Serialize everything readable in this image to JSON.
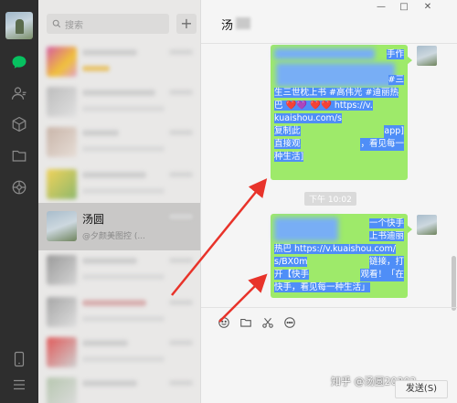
{
  "sidebar": {
    "icons": [
      "chat-icon",
      "contacts-icon",
      "favorites-icon",
      "files-icon",
      "moments-icon",
      "phone-icon",
      "menu-icon"
    ]
  },
  "list": {
    "search_placeholder": "搜索",
    "add_label": "+",
    "selected_chat": {
      "name": "汤圆",
      "preview": "@夕颜美图控 (..."
    }
  },
  "chat": {
    "title": "汤",
    "window_controls": [
      "—",
      "□",
      "✕"
    ],
    "message1": {
      "lines": [
        "手作",
        "",
        "#三",
        "生三世枕上书 #高伟光 #迪丽热",
        "巴 ❤️💜 ❤️❤️ https://v.",
        "kuaishou.com/s",
        "复制此",
        "app]",
        "直接观",
        "，看见每一",
        "种生活]"
      ]
    },
    "timestamp": "下午 10:02",
    "message2": {
      "lines": [
        "一个快手",
        "上书迪丽",
        "热巴 https://v.kuaishou.com/",
        "s/BX0m",
        "链接，打",
        "开【快手",
        "观看！「在",
        "快手，看见每一种生活」"
      ]
    },
    "toolbar_icons": [
      "emoji-icon",
      "folder-icon",
      "scissors-icon",
      "bubble-icon"
    ],
    "send_label": "发送(S)",
    "watermark": "知乎 @汤圆20302"
  },
  "colors": {
    "accent": "#07c160",
    "bubble": "#9eea6a",
    "selection": "#4f8ef7",
    "arrow": "#e8332a"
  }
}
